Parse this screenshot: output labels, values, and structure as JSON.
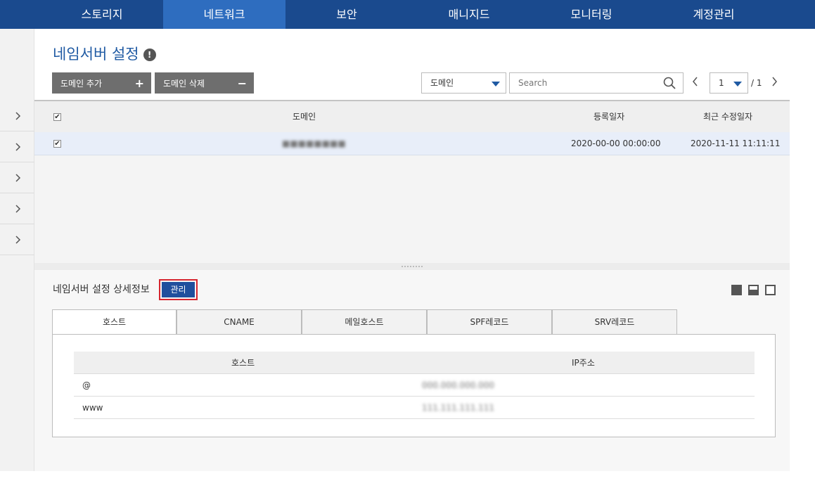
{
  "topnav": {
    "tabs": [
      {
        "label": "스토리지"
      },
      {
        "label": "네트워크"
      },
      {
        "label": "보안"
      },
      {
        "label": "매니지드"
      },
      {
        "label": "모니터링"
      },
      {
        "label": "계정관리"
      }
    ],
    "active": "네트워크"
  },
  "page": {
    "title": "네임서버 설정",
    "info_icon": "info-circle-icon"
  },
  "toolbar": {
    "add_label": "도메인 추가",
    "add_symbol": "+",
    "delete_label": "도메인 삭제",
    "delete_symbol": "−",
    "filter_value": "도메인",
    "search_placeholder": "Search",
    "page_current": "1",
    "page_total": "/ 1"
  },
  "domain_table": {
    "headers": {
      "domain": "도메인",
      "registered": "등록일자",
      "modified": "최근 수정일자"
    },
    "rows": [
      {
        "domain": "■■■■■■■■",
        "registered": "2020-00-00 00:00:00",
        "modified": "2020-11-11 11:11:11",
        "checked": true
      }
    ],
    "header_checked": true
  },
  "detail": {
    "title": "네임서버 설정 상세정보",
    "manage_label": "관리",
    "tabs": [
      "호스트",
      "CNAME",
      "메일호스트",
      "SPF레코드",
      "SRV레코드"
    ],
    "active_tab": "호스트",
    "host_table": {
      "headers": {
        "host": "호스트",
        "ip": "IP주소"
      },
      "rows": [
        {
          "host": "@",
          "ip": "000.000.000.000"
        },
        {
          "host": "www",
          "ip": "111.111.111.111"
        }
      ]
    }
  },
  "colors": {
    "nav_bg": "#1a4a8e",
    "nav_active": "#2e6dbf",
    "accent": "#1f5aa3",
    "highlight_border": "#d6262f"
  }
}
